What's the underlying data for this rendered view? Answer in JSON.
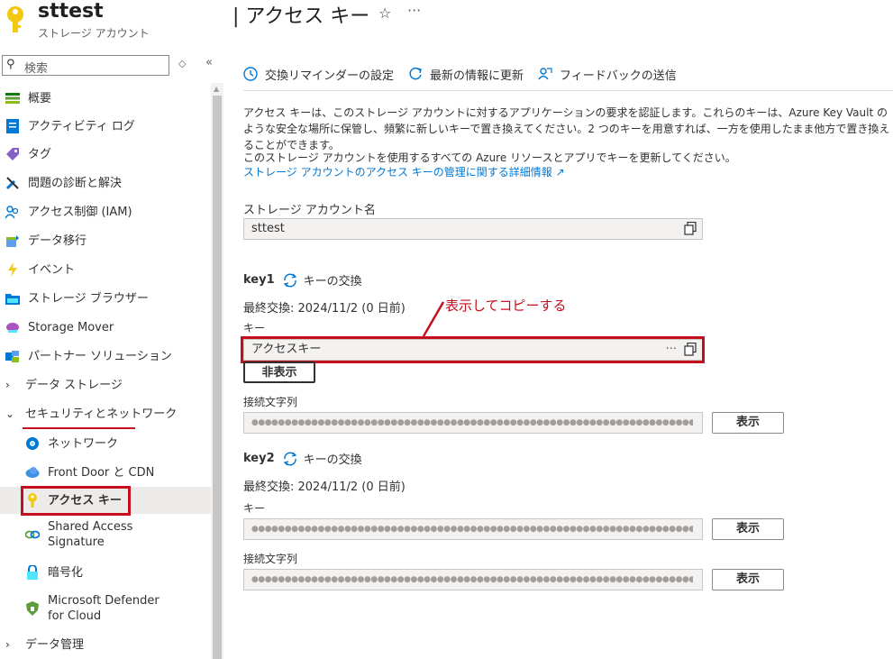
{
  "header": {
    "resource_name": "sttest",
    "resource_type": "ストレージ アカウント",
    "page_title": "| アクセス キー",
    "star_icon": "☆",
    "more_icon": "···"
  },
  "sidebar": {
    "search_placeholder": "検索",
    "items": [
      {
        "label": "概要",
        "icon": "overview-icon"
      },
      {
        "label": "アクティビティ ログ",
        "icon": "activity-log-icon"
      },
      {
        "label": "タグ",
        "icon": "tag-icon"
      },
      {
        "label": "問題の診断と解決",
        "icon": "wrench-icon"
      },
      {
        "label": "アクセス制御 (IAM)",
        "icon": "people-icon"
      },
      {
        "label": "データ移行",
        "icon": "migration-icon"
      },
      {
        "label": "イベント",
        "icon": "lightning-icon"
      },
      {
        "label": "ストレージ ブラウザー",
        "icon": "folder-icon"
      },
      {
        "label": "Storage Mover",
        "icon": "cloud-mover-icon"
      },
      {
        "label": "パートナー ソリューション",
        "icon": "partner-icon"
      },
      {
        "label": "データ ストレージ",
        "icon": "chevron-right-icon"
      },
      {
        "label": "セキュリティとネットワーク",
        "icon": "chevron-down-icon"
      },
      {
        "label": "ネットワーク",
        "icon": "network-icon"
      },
      {
        "label": "Front Door と CDN",
        "icon": "cloud-icon"
      },
      {
        "label": "アクセス キー",
        "icon": "key-icon"
      },
      {
        "label": "Shared Access Signature",
        "icon": "link-icon"
      },
      {
        "label": "暗号化",
        "icon": "lock-icon"
      },
      {
        "label": "Microsoft Defender for Cloud",
        "icon": "shield-icon"
      },
      {
        "label": "データ管理",
        "icon": "chevron-right-icon"
      }
    ]
  },
  "toolbar": {
    "reminder": "交換リマインダーの設定",
    "refresh": "最新の情報に更新",
    "feedback": "フィードバックの送信"
  },
  "description": {
    "p1": "アクセス キーは、このストレージ アカウントに対するアプリケーションの要求を認証します。これらのキーは、Azure Key Vault のような安全な場所に保管し、頻繁に新しいキーで置き換えてください。2 つのキーを用意すれば、一方を使用したまま他方で置き換えることができます。",
    "p2": "このストレージ アカウントを使用するすべての Azure リソースとアプリでキーを更新してください。",
    "link": "ストレージ アカウントのアクセス キーの管理に関する詳細情報 ↗"
  },
  "account": {
    "label": "ストレージ アカウント名",
    "value": "sttest"
  },
  "key1": {
    "name": "key1",
    "rotate": "キーの交換",
    "last_rotated": "最終交換: 2024/11/2 (0 日前)",
    "key_label": "キー",
    "key_value": "アクセスキー",
    "key_more": "···",
    "hide_button": "非表示",
    "conn_label": "接続文字列",
    "conn_masked": "●●●●●●●●●●●●●●●●●●●●●●●●●●●●●●●●●●●●●●●●●●●●●●●●●●●●●●●●●●●●●●●●●●●●●●●●●●●●●●●●●●●●●●●●●●●●●●●●●●●●●●●●●●●●",
    "show_button": "表示"
  },
  "key2": {
    "name": "key2",
    "rotate": "キーの交換",
    "last_rotated": "最終交換: 2024/11/2 (0 日前)",
    "key_label": "キー",
    "key_masked": "●●●●●●●●●●●●●●●●●●●●●●●●●●●●●●●●●●●●●●●●●●●●●●●●●●●●●●●●●●●●●●●●●●●●●●●●●●●●●●●●●●●●●●●●●●●●●●●●●●●●●●●●●●●●",
    "key_show_button": "表示",
    "conn_label": "接続文字列",
    "conn_masked": "●●●●●●●●●●●●●●●●●●●●●●●●●●●●●●●●●●●●●●●●●●●●●●●●●●●●●●●●●●●●●●●●●●●●●●●●●●●●●●●●●●●●●●●●●●●●●●●●●●●●●●●●●●●●",
    "conn_show_button": "表示"
  },
  "annotation": {
    "text": "表示してコピーする",
    "color": "#c50f1f"
  }
}
